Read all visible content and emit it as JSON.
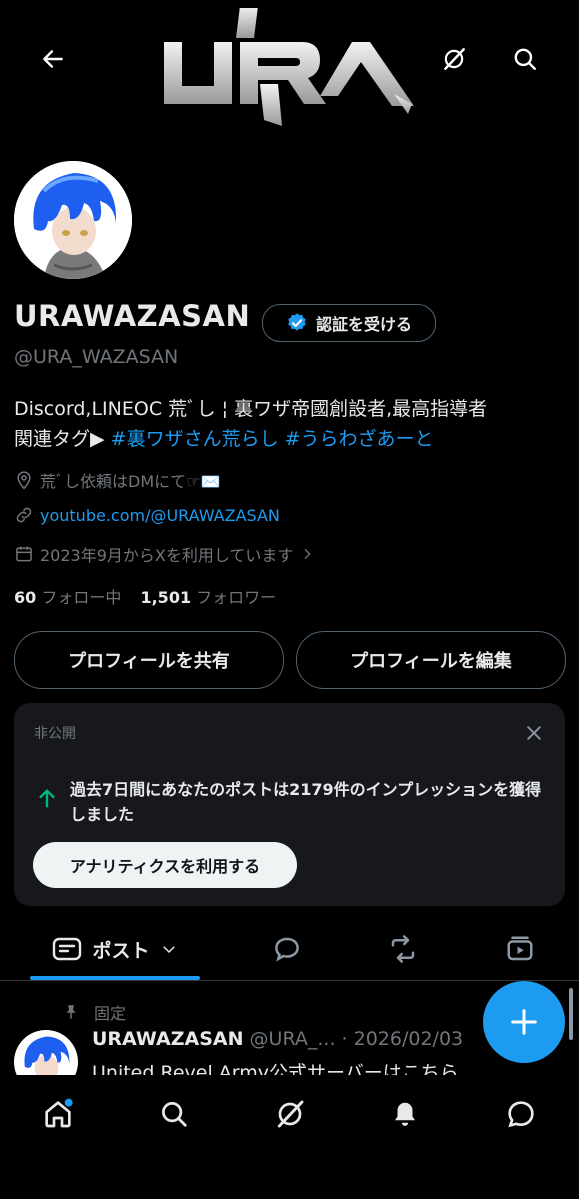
{
  "header": {
    "back_icon": "back-arrow-icon",
    "logo_text": "URA",
    "grok_icon": "grok-icon",
    "search_icon": "search-icon"
  },
  "profile": {
    "display_name": "URAWAZASAN",
    "verify_label": "認証を受ける",
    "handle": "@URA_WAZASAN",
    "bio_line1": "Discord,LINEOC 荒ﾞし ¦ 裏ワザ帝國創設者,最高指導者",
    "bio_line2_prefix": "関連タグ▶",
    "bio_tag1": "#裏ワザさん荒らし",
    "bio_tag2": "#うらわざあーと",
    "location": "荒ﾞし依頼はDMにて☞✉️",
    "website": "youtube.com/@URAWAZASAN",
    "joined": "2023年9月からXを利用しています",
    "following_count": "60",
    "following_label": "フォロー中",
    "followers_count": "1,501",
    "followers_label": "フォロワー"
  },
  "actions": {
    "share_label": "プロフィールを共有",
    "edit_label": "プロフィールを編集"
  },
  "private_card": {
    "label": "非公開",
    "message": "過去7日間にあなたのポストは2179件のインプレッションを獲得しました",
    "cta_label": "アナリティクスを利用する"
  },
  "tabs": {
    "posts_label": "ポスト"
  },
  "pinned_post": {
    "pinned_label": "固定",
    "author_name": "URAWAZASAN",
    "author_handle_date": "@URA_... · 2026/02/03",
    "text": "United Revel Army公式サーバーはこちら"
  },
  "colors": {
    "accent": "#1d9bf0",
    "background": "#000000",
    "card": "#16181c",
    "muted": "#71767b",
    "positive": "#00ba7c"
  }
}
